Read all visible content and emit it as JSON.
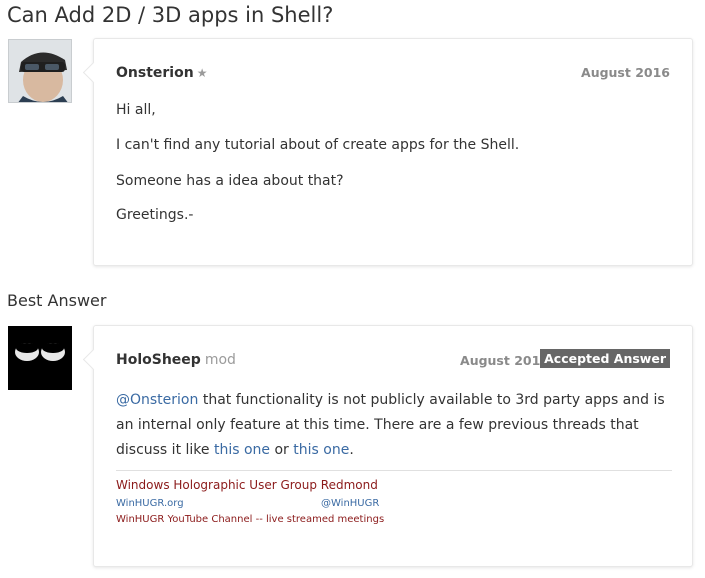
{
  "thread": {
    "title": "Can Add 2D / 3D apps in Shell?"
  },
  "question": {
    "author": "Onsterion",
    "star": "★",
    "date": "August 2016",
    "paragraphs": [
      "Hi all,",
      "I can't find any tutorial about of create apps for the Shell.",
      "Someone has a idea about that?",
      "Greetings.-"
    ]
  },
  "best_answer": {
    "heading": "Best Answer",
    "author": "HoloSheep",
    "role": "mod",
    "date": "August 2016",
    "badge": "Accepted Answer",
    "mention": "@Onsterion",
    "text_1": " that functionality is not publicly available to 3rd party apps and is an internal only feature at this time. There are a few previous threads that discuss it like ",
    "link_1": "this one",
    "text_2": " or ",
    "link_2": "this one",
    "text_3": ".",
    "signature": {
      "title": "Windows Holographic User Group Redmond",
      "link_site": "WinHUGR.org",
      "link_twitter": "@WinHUGR",
      "link_youtube": "WinHUGR YouTube Channel",
      "youtube_suffix": " -- live streamed meetings"
    }
  },
  "colors": {
    "link": "#3a6aa3",
    "signature_red": "#8b1a1a",
    "badge_bg": "#666666"
  }
}
